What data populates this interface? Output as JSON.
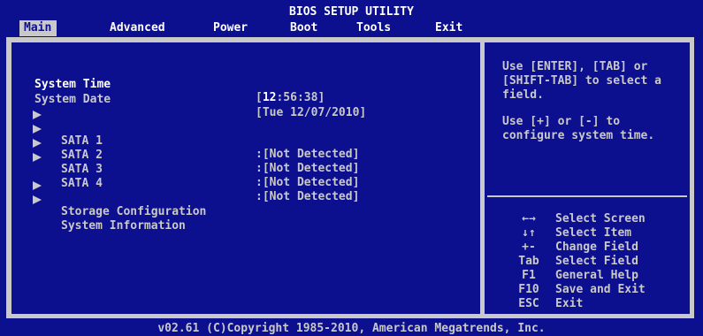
{
  "title": "BIOS SETUP UTILITY",
  "menu": [
    "Main",
    "Advanced",
    "Power",
    "Boot",
    "Tools",
    "Exit"
  ],
  "main": {
    "system_time_label": "System Time",
    "system_time_value": "[12:56:38]",
    "system_time_highlight": "12",
    "system_date_label": "System Date",
    "system_date_value": "[Tue 12/07/2010]",
    "sata": [
      {
        "label": "SATA 1",
        "value": ":[Not Detected]"
      },
      {
        "label": "SATA 2",
        "value": ":[Not Detected]"
      },
      {
        "label": "SATA 3",
        "value": ":[Not Detected]"
      },
      {
        "label": "SATA 4",
        "value": ":[Not Detected]"
      }
    ],
    "submenus": [
      "Storage Configuration",
      "System Information"
    ]
  },
  "help": {
    "line1": "Use [ENTER], [TAB] or [SHIFT-TAB] to select a field.",
    "line2": "Use [+] or [-] to configure system time."
  },
  "keys": [
    {
      "key": "←→",
      "desc": "Select Screen"
    },
    {
      "key": "↓↑",
      "desc": "Select Item"
    },
    {
      "key": "+-",
      "desc": "Change Field"
    },
    {
      "key": "Tab",
      "desc": "Select Field"
    },
    {
      "key": "F1",
      "desc": "General Help"
    },
    {
      "key": "F10",
      "desc": "Save and Exit"
    },
    {
      "key": "ESC",
      "desc": "Exit"
    }
  ],
  "footer": "v02.61 (C)Copyright 1985-2010, American Megatrends, Inc.",
  "colors": {
    "background": "#0c0f8e",
    "text": "#c9c9c9",
    "highlight": "#ffffff"
  }
}
